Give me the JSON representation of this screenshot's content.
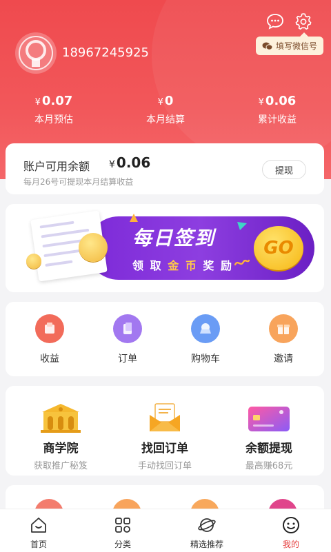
{
  "header": {
    "wechat_tip": "填写微信号",
    "phone": "18967245925",
    "stats": [
      {
        "currency": "¥",
        "value": "0.07",
        "label": "本月预估"
      },
      {
        "currency": "¥",
        "value": "0",
        "label": "本月结算"
      },
      {
        "currency": "¥",
        "value": "0.06",
        "label": "累计收益"
      }
    ]
  },
  "balance": {
    "title": "账户可用余额",
    "currency": "¥",
    "amount": "0.06",
    "note": "每月26号可提现本月结算收益",
    "withdraw_label": "提现"
  },
  "banner": {
    "title": "每日签到",
    "sub": [
      "领",
      "取",
      "金",
      "币",
      "奖",
      "励"
    ],
    "go_label": "GO",
    "colors": {
      "pill": "#7d2ad8",
      "go": "#f6b611"
    }
  },
  "menu": {
    "items": [
      {
        "label": "收益",
        "icon": "income-icon",
        "color": "#f26b5a"
      },
      {
        "label": "订单",
        "icon": "order-icon",
        "color": "#a278f0"
      },
      {
        "label": "购物车",
        "icon": "cart-icon",
        "color": "#6a9cf5"
      },
      {
        "label": "邀请",
        "icon": "gift-icon",
        "color": "#f8a45c"
      }
    ]
  },
  "features": {
    "items": [
      {
        "title": "商学院",
        "sub": "获取推广秘笈",
        "icon": "academy-icon"
      },
      {
        "title": "找回订单",
        "sub": "手动找回订单",
        "icon": "envelope-icon"
      },
      {
        "title": "余额提现",
        "sub": "最高赚68元",
        "icon": "card-icon"
      }
    ]
  },
  "tabbar": {
    "tabs": [
      {
        "label": "首页",
        "icon": "home-icon"
      },
      {
        "label": "分类",
        "icon": "category-icon"
      },
      {
        "label": "精选推荐",
        "icon": "planet-icon"
      },
      {
        "label": "我的",
        "icon": "profile-icon"
      }
    ],
    "active_index": 3,
    "active_color": "#e53d3d"
  }
}
